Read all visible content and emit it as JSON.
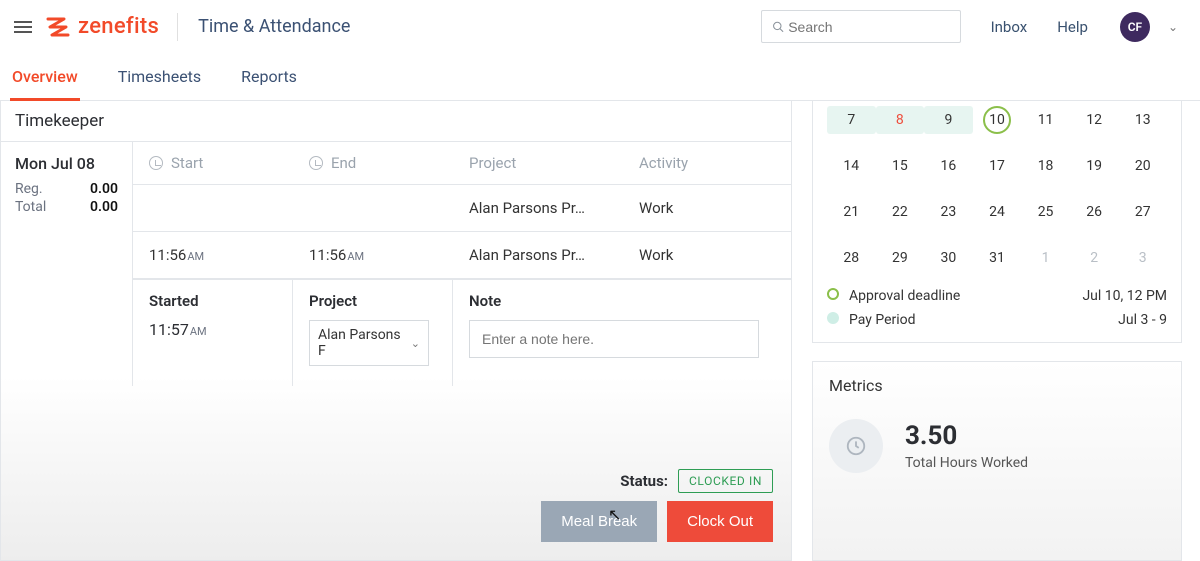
{
  "brand": {
    "name": "zenefits"
  },
  "header": {
    "app_title": "Time & Attendance",
    "search_placeholder": "Search",
    "links": {
      "inbox": "Inbox",
      "help": "Help"
    },
    "avatar_initials": "CF"
  },
  "tabs": [
    {
      "id": "overview",
      "label": "Overview",
      "active": true
    },
    {
      "id": "timesheets",
      "label": "Timesheets",
      "active": false
    },
    {
      "id": "reports",
      "label": "Reports",
      "active": false
    }
  ],
  "timekeeper": {
    "title": "Timekeeper",
    "day": {
      "date_label": "Mon Jul 08",
      "reg_label": "Reg.",
      "reg_value": "0.00",
      "total_label": "Total",
      "total_value": "0.00"
    },
    "columns": {
      "start": "Start",
      "end": "End",
      "project": "Project",
      "activity": "Activity"
    },
    "rows": [
      {
        "start": "",
        "start_ampm": "",
        "end": "",
        "end_ampm": "",
        "project": "Alan Parsons Pr…",
        "activity": "Work"
      },
      {
        "start": "11:56",
        "start_ampm": "AM",
        "end": "11:56",
        "end_ampm": "AM",
        "project": "Alan Parsons Pr…",
        "activity": "Work"
      }
    ],
    "panel": {
      "started_label": "Started",
      "started_time": "11:57",
      "started_ampm": "AM",
      "project_label": "Project",
      "project_value": "Alan Parsons F",
      "note_label": "Note",
      "note_placeholder": "Enter a note here."
    },
    "status_label": "Status:",
    "status_value": "CLOCKED IN",
    "buttons": {
      "meal_break": "Meal Break",
      "clock_out": "Clock Out"
    }
  },
  "calendar": {
    "cells": [
      {
        "n": "7",
        "cls": "pp"
      },
      {
        "n": "8",
        "cls": "pp today"
      },
      {
        "n": "9",
        "cls": "pp"
      },
      {
        "n": "10",
        "cls": "deadline"
      },
      {
        "n": "11"
      },
      {
        "n": "12"
      },
      {
        "n": "13"
      },
      {
        "n": "14"
      },
      {
        "n": "15"
      },
      {
        "n": "16"
      },
      {
        "n": "17"
      },
      {
        "n": "18"
      },
      {
        "n": "19"
      },
      {
        "n": "20"
      },
      {
        "n": "21"
      },
      {
        "n": "22"
      },
      {
        "n": "23"
      },
      {
        "n": "24"
      },
      {
        "n": "25"
      },
      {
        "n": "26"
      },
      {
        "n": "27"
      },
      {
        "n": "28"
      },
      {
        "n": "29"
      },
      {
        "n": "30"
      },
      {
        "n": "31"
      },
      {
        "n": "1",
        "cls": "dim"
      },
      {
        "n": "2",
        "cls": "dim"
      },
      {
        "n": "3",
        "cls": "dim"
      }
    ],
    "legend": {
      "approval_label": "Approval deadline",
      "approval_value": "Jul 10, 12 PM",
      "payperiod_label": "Pay Period",
      "payperiod_value": "Jul 3 - 9"
    }
  },
  "metrics": {
    "title": "Metrics",
    "value": "3.50",
    "label": "Total Hours Worked"
  }
}
